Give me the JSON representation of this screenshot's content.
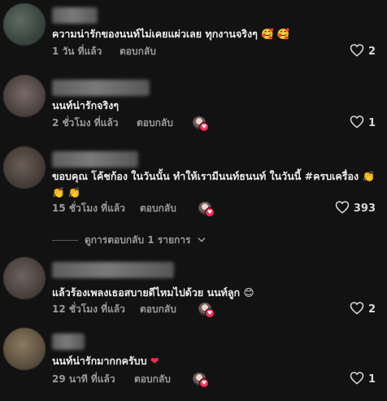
{
  "comments": [
    {
      "text": "ความน่ารักของนนท์ไม่เคยแผ่วเลย ทุกงานจริงๆ",
      "emoji": "🥰 🥰",
      "time": "1 วัน ที่แล้ว",
      "reply_label": "ตอบกลับ",
      "likes": "2",
      "liked_by_creator": false
    },
    {
      "text": "นนท์น่ารักจริงๆ",
      "emoji": "",
      "time": "2 ชั่วโมง ที่แล้ว",
      "reply_label": "ตอบกลับ",
      "likes": "1",
      "liked_by_creator": true
    },
    {
      "text": "ขอบคุณ โค้ชก้อง ในวันนั้น ทำให้เรามีนนท์ธนนท์ ในวันนี้ #ครบเครื่อง",
      "emoji": "👏",
      "emoji_line2": "👏 👏",
      "time": "15 ชั่วโมง ที่แล้ว",
      "reply_label": "ตอบกลับ",
      "likes": "393",
      "liked_by_creator": true,
      "view_replies_label": "ดูการตอบกลับ 1 รายการ"
    },
    {
      "text": "แล้วร้องเพลงเธอสบายดีไหมไปด้วย นนท์ลูก",
      "emoji": "😊",
      "time": "12 ชั่วโมง ที่แล้ว",
      "reply_label": "ตอบกลับ",
      "likes": "2",
      "liked_by_creator": true
    },
    {
      "text": "นนท์น่ารักมากกครับบ",
      "emoji": "❤",
      "time": "29 นาที ที่แล้ว",
      "reply_label": "ตอบกลับ",
      "likes": "1",
      "liked_by_creator": true
    }
  ],
  "colors": {
    "background": "#121212",
    "text": "#ececec",
    "meta": "#9a9a9a",
    "creator_badge": "#fe2c55",
    "heart_emoji": "#fe2c55"
  },
  "icons": {
    "like": "heart-outline-icon",
    "expand": "chevron-down-icon",
    "creator_like": "creator-avatar-heart-badge"
  }
}
